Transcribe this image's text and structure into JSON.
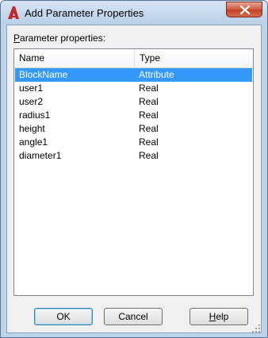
{
  "window": {
    "title": "Add Parameter Properties",
    "app_icon": "autocad-a-icon",
    "close_icon": "close-icon"
  },
  "section": {
    "label_accel": "P",
    "label_rest": "arameter properties:"
  },
  "table": {
    "columns": [
      "Name",
      "Type"
    ],
    "rows": [
      {
        "name": "BlockName",
        "type": "Attribute",
        "selected": true
      },
      {
        "name": "user1",
        "type": "Real",
        "selected": false
      },
      {
        "name": "user2",
        "type": "Real",
        "selected": false
      },
      {
        "name": "radius1",
        "type": "Real",
        "selected": false
      },
      {
        "name": "height",
        "type": "Real",
        "selected": false
      },
      {
        "name": "angle1",
        "type": "Real",
        "selected": false
      },
      {
        "name": "diameter1",
        "type": "Real",
        "selected": false
      }
    ]
  },
  "buttons": {
    "ok": "OK",
    "cancel": "Cancel",
    "help_accel": "H",
    "help_rest": "elp"
  },
  "colors": {
    "selection": "#3399ff",
    "titlebar": "#c4d8ee",
    "close_button": "#c94a32"
  }
}
